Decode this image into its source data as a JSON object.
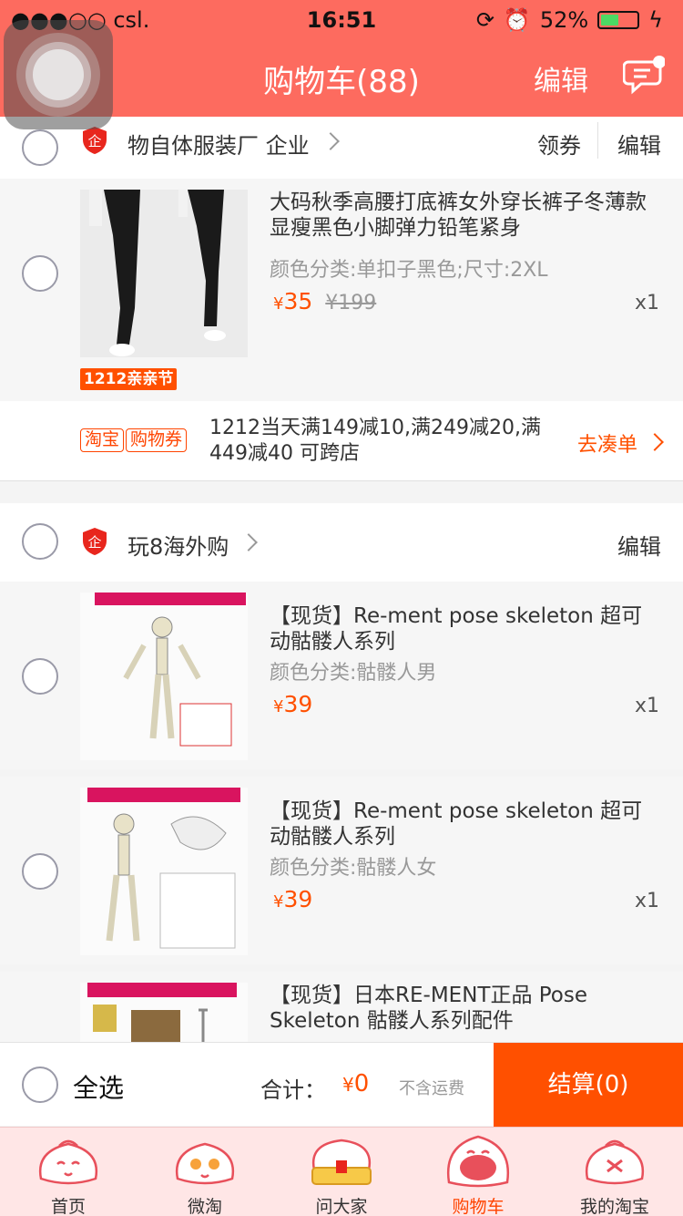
{
  "status_bar": {
    "carrier": "●●●○○ csl.",
    "time": "16:51",
    "battery": "52%"
  },
  "header": {
    "title": "购物车(88)",
    "edit_label": "编辑"
  },
  "shops": [
    {
      "name": "物自体服装厂 企业",
      "coupon_label": "领券",
      "edit_label": "编辑"
    },
    {
      "name": "玩8海外购",
      "edit_label": "编辑"
    }
  ],
  "items": [
    {
      "title": "大码秋季高腰打底裤女外穿长裤子冬薄款显瘦黑色小脚弹力铅笔紧身",
      "spec": "颜色分类:单扣子黑色;尺寸:2XL",
      "price": "35",
      "old_price": "¥199",
      "qty": "x1",
      "badge": "1212亲亲节"
    },
    {
      "title": "【现货】Re-ment pose skeleton 超可动骷髅人系列",
      "spec": "颜色分类:骷髅人男",
      "price": "39",
      "qty": "x1"
    },
    {
      "title": "【现货】Re-ment pose skeleton 超可动骷髅人系列",
      "spec": "颜色分类:骷髅人女",
      "price": "39",
      "qty": "x1"
    },
    {
      "title": "【现货】日本RE-MENT正品 Pose Skeleton 骷髅人系列配件"
    }
  ],
  "promo": {
    "tag1": "淘宝",
    "tag2": "购物券",
    "text": "1212当天满149减10,满249减20,满449减40 可跨店",
    "action": "去凑单"
  },
  "bottom": {
    "select_all": "全选",
    "total_label": "合计：",
    "currency": "¥",
    "total": "0",
    "shipping_note": "不含运费",
    "checkout": "结算(0)"
  },
  "currency_symbol": "¥",
  "tabs": [
    {
      "label": "首页"
    },
    {
      "label": "微淘"
    },
    {
      "label": "问大家"
    },
    {
      "label": "购物车"
    },
    {
      "label": "我的淘宝"
    }
  ],
  "colors": {
    "header": "#fd6b5f",
    "accent": "#ff5000",
    "tabbar": "#ffe6e6"
  }
}
